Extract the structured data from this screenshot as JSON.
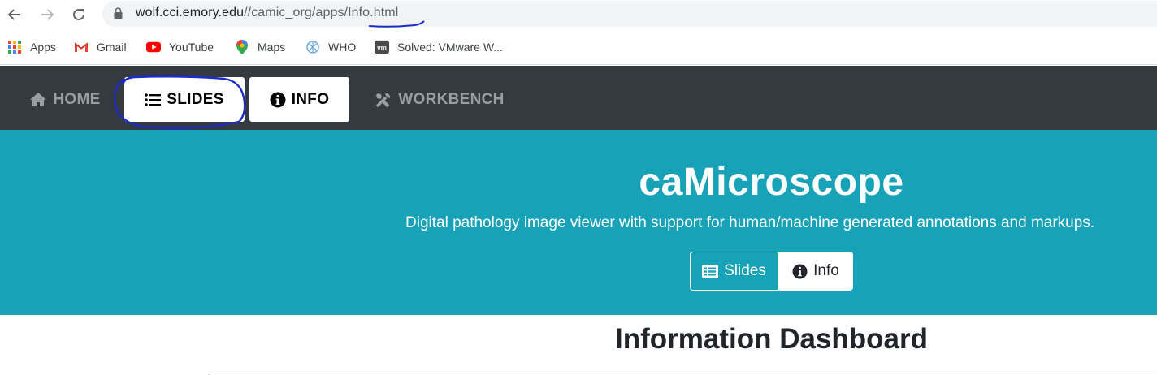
{
  "browser": {
    "url_host": "wolf.cci.emory.edu",
    "url_path": "//camic_org/apps/Info.html",
    "bookmarks": [
      {
        "label": "Apps",
        "icon": "apps-grid-icon"
      },
      {
        "label": "Gmail",
        "icon": "gmail-icon"
      },
      {
        "label": "YouTube",
        "icon": "youtube-icon"
      },
      {
        "label": "Maps",
        "icon": "maps-pin-icon"
      },
      {
        "label": "WHO",
        "icon": "who-icon"
      },
      {
        "label": "Solved: VMware W...",
        "icon": "vmware-icon"
      }
    ]
  },
  "navbar": {
    "items": [
      {
        "label": "HOME",
        "icon": "home-icon",
        "active": false
      },
      {
        "label": "SLIDES",
        "icon": "list-icon",
        "active": true
      },
      {
        "label": "INFO",
        "icon": "info-circle-icon",
        "active": true
      },
      {
        "label": "WORKBENCH",
        "icon": "tools-icon",
        "active": false
      }
    ]
  },
  "hero": {
    "title": "caMicroscope",
    "subtitle": "Digital pathology image viewer with support for human/machine generated annotations and markups.",
    "buttons": [
      {
        "label": "Slides",
        "icon": "list-alt-icon"
      },
      {
        "label": "Info",
        "icon": "info-circle-icon"
      }
    ]
  },
  "content": {
    "title": "Information Dashboard"
  },
  "colors": {
    "navbar_bg": "#343a40",
    "hero_bg": "#17a2b8",
    "annotation_ink": "#1a2bc9"
  }
}
